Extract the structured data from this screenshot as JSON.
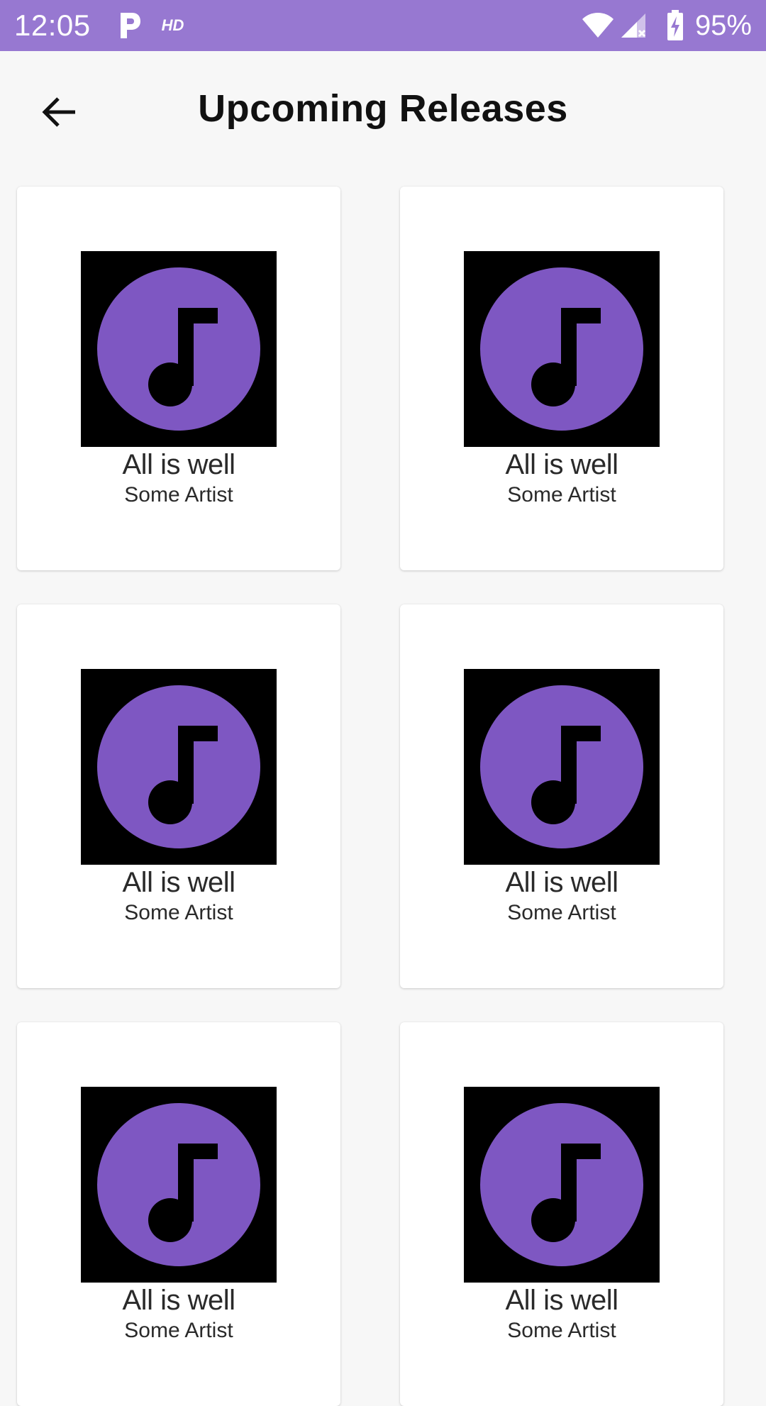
{
  "status_bar": {
    "time": "12:05",
    "hd_label": "HD",
    "battery_percent": "95%",
    "background_color": "#9778d1",
    "icons": [
      "p-icon",
      "wifi-icon",
      "signal-icon",
      "battery-icon"
    ]
  },
  "header": {
    "title": "Upcoming Releases",
    "back_icon": "arrow-left-icon"
  },
  "releases": [
    {
      "title": "All is well",
      "artist": "Some Artist"
    },
    {
      "title": "All is well",
      "artist": "Some Artist"
    },
    {
      "title": "All is well",
      "artist": "Some Artist"
    },
    {
      "title": "All is well",
      "artist": "Some Artist"
    },
    {
      "title": "All is well",
      "artist": "Some Artist"
    },
    {
      "title": "All is well",
      "artist": "Some Artist"
    }
  ],
  "colors": {
    "accent": "#7e57c2",
    "cover_background": "#000000"
  }
}
